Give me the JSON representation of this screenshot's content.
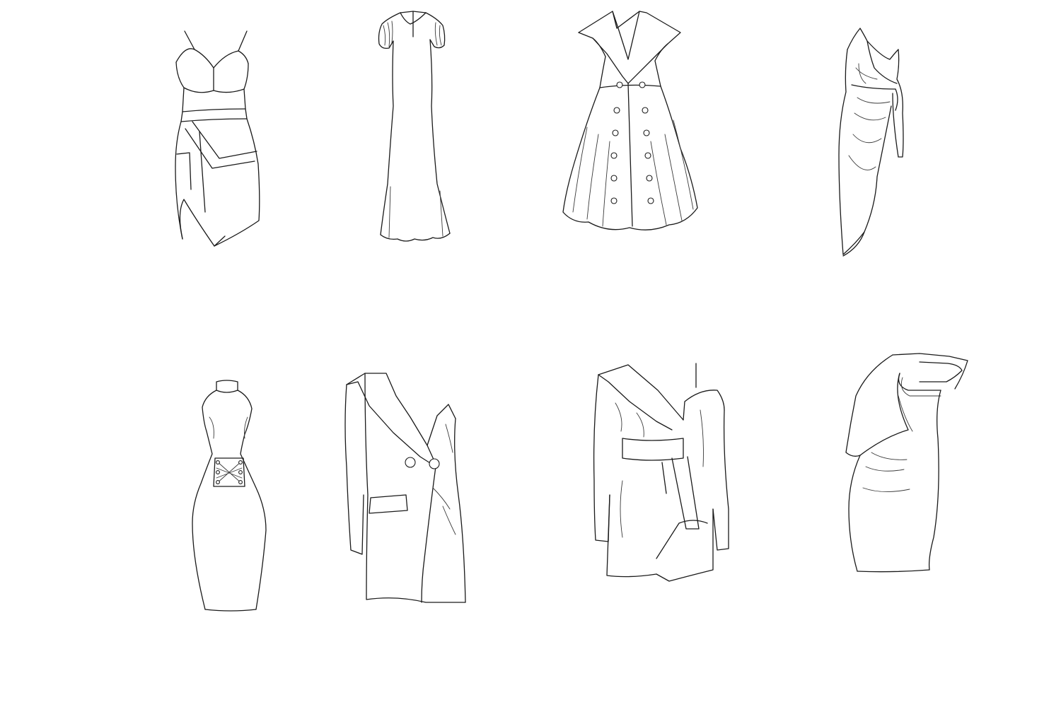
{
  "sheet": {
    "background": "#ffffff",
    "line_color": "#1a1a1a",
    "rows": 2,
    "columns": 4
  },
  "sketches": [
    {
      "row": 1,
      "col": 1,
      "subject": "bustier-dress-icon"
    },
    {
      "row": 1,
      "col": 2,
      "subject": "column-gown-icon"
    },
    {
      "row": 1,
      "col": 3,
      "subject": "double-breasted-coat-dress-icon"
    },
    {
      "row": 1,
      "col": 4,
      "subject": "one-shoulder-draped-dress-icon"
    },
    {
      "row": 2,
      "col": 1,
      "subject": "halter-lace-up-dress-icon"
    },
    {
      "row": 2,
      "col": 2,
      "subject": "blazer-dress-icon"
    },
    {
      "row": 2,
      "col": 3,
      "subject": "wrap-belted-jacket-dress-icon"
    },
    {
      "row": 2,
      "col": 4,
      "subject": "ruffle-one-shoulder-dress-icon"
    }
  ]
}
